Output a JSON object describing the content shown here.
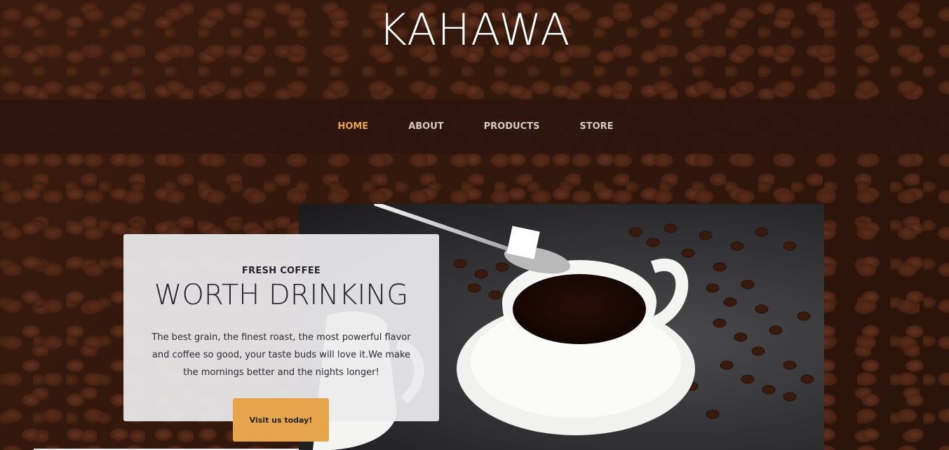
{
  "site": {
    "title": "KAHAWA"
  },
  "nav": {
    "items": [
      {
        "label": "HOME",
        "active": true
      },
      {
        "label": "ABOUT",
        "active": false
      },
      {
        "label": "PRODUCTS",
        "active": false
      },
      {
        "label": "STORE",
        "active": false
      }
    ]
  },
  "intro": {
    "kicker": "FRESH COFFEE",
    "heading": "WORTH DRINKING",
    "body": "The best grain, the finest roast, the most powerful flavor and coffee so good, your taste buds will love it.We make the mornings better and the nights longer!",
    "cta_label": "Visit us today!"
  },
  "colors": {
    "accent": "#e6a54a",
    "nav_background": "#2d160e",
    "card_background": "#ececee",
    "text_dark": "#25252b"
  },
  "icons": {
    "hero_photo": "coffee-cup-with-sugar-spoon-and-beans"
  }
}
